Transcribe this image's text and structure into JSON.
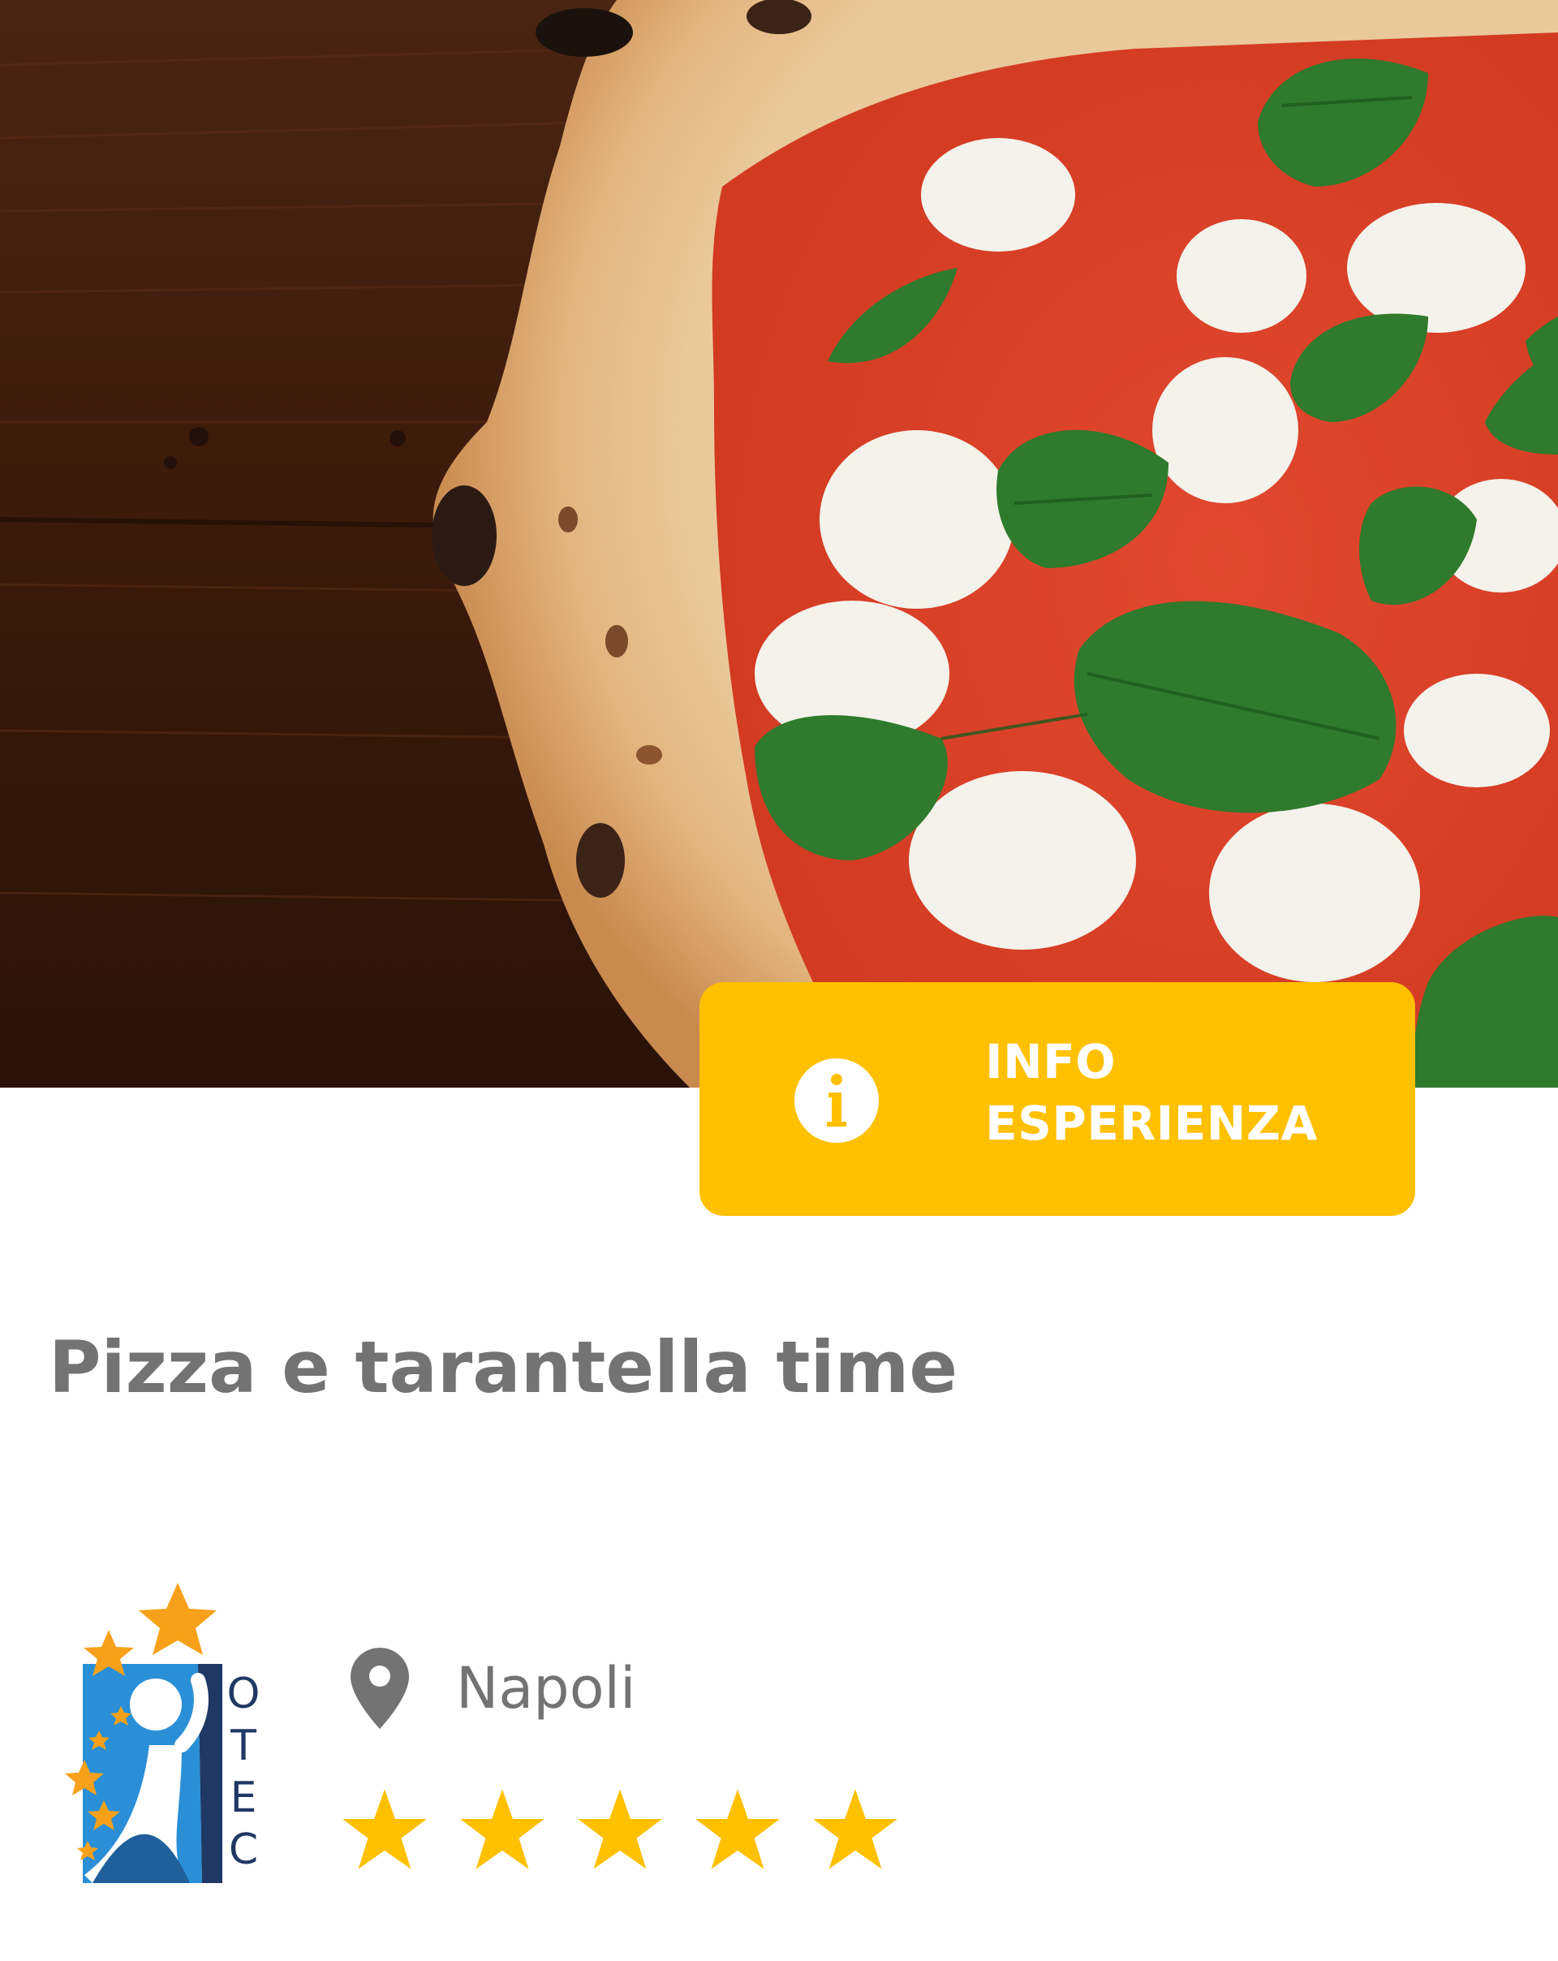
{
  "hero": {
    "image": "pizza-margherita-photo"
  },
  "info_button": {
    "line1": "INFO",
    "line2": "ESPERIENZA",
    "icon": "info-icon"
  },
  "title": "Pizza e tarantella time",
  "logo": {
    "letters": [
      "O",
      "T",
      "E",
      "C"
    ]
  },
  "location": {
    "icon": "location-pin-icon",
    "city": "Napoli"
  },
  "rating": {
    "value": 5,
    "max": 5,
    "icon": "star-icon"
  },
  "colors": {
    "accent": "#ffc000",
    "text_gray": "#737373",
    "logo_blue": "#1f3864",
    "logo_light_blue": "#2a8fd6",
    "star": "#ffc000"
  }
}
